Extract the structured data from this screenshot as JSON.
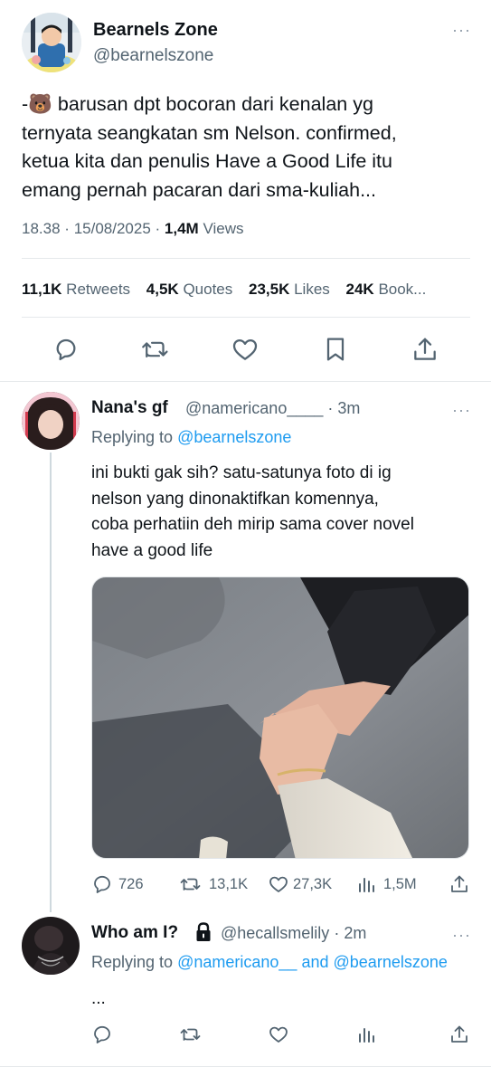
{
  "main_tweet": {
    "author": "Bearnels Zone",
    "handle": "@bearnelszone",
    "text_line1": "-🐻 barusan dpt bocoran dari kenalan yg",
    "text_line2": "ternyata seangkatan sm Nelson. confirmed,",
    "text_line3": "ketua kita dan penulis Have a Good Life itu",
    "text_line4": "emang pernah pacaran dari sma-kuliah...",
    "time": "18.38",
    "date": "15/08/2025",
    "views_count": "1,4M",
    "views_label": "Views",
    "stats": {
      "retweets_count": "11,1K",
      "retweets_label": "Retweets",
      "quotes_count": "4,5K",
      "quotes_label": "Quotes",
      "likes_count": "23,5K",
      "likes_label": "Likes",
      "bookmarks_count": "24K",
      "bookmarks_label": "Book..."
    }
  },
  "reply1": {
    "author": "Nana's gf",
    "handle": "@namericano____",
    "time": "3m",
    "replying_prefix": "Replying to",
    "replying_to": "@bearnelszone",
    "text_line1": "ini bukti gak sih? satu-satunya foto di ig",
    "text_line2": "nelson yang dinonaktifkan komennya,",
    "text_line3": "coba perhatiin deh mirip sama cover novel",
    "text_line4": "have a good life",
    "replies": "726",
    "retweets": "13,1K",
    "likes": "27,3K",
    "views": "1,5M"
  },
  "reply2": {
    "author": "Who am I?",
    "handle": "@hecallsmelily",
    "time": "2m",
    "replying_prefix": "Replying to",
    "replying_to_1": "@namericano__",
    "replying_and": "and",
    "replying_to_2": "@bearnelszone",
    "text": "..."
  },
  "ui": {
    "more": "···",
    "dot": "·"
  },
  "icons": {
    "reply": "comment-bubble-icon",
    "retweet": "retweet-arrows-icon",
    "like": "heart-icon",
    "bookmark": "bookmark-icon",
    "share": "share-upload-icon",
    "views": "bar-chart-icon",
    "lock": "lock-icon"
  },
  "colors": {
    "link": "#1d9bf0",
    "secondary_text": "#536471",
    "primary_text": "#0f1419",
    "thread_line": "#cfd9de"
  }
}
